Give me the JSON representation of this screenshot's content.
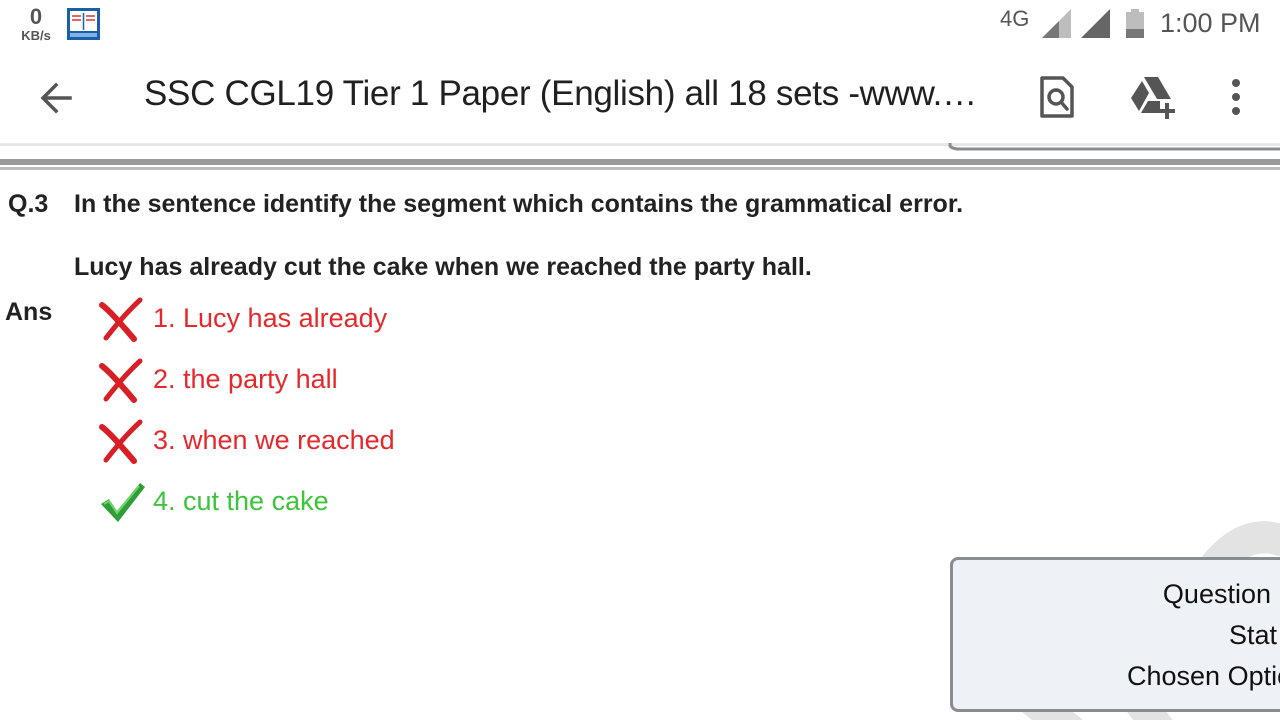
{
  "status_bar": {
    "speed_value": "0",
    "speed_unit": "KB/s",
    "network": "4G",
    "time": "1:00 PM",
    "icons": [
      "app-notification-icon",
      "signal-icon",
      "signal-icon",
      "battery-icon"
    ]
  },
  "toolbar": {
    "title": "SSC CGL19 Tier 1 Paper (English) all 18 sets -www.q...",
    "icons": [
      "back-arrow-icon",
      "find-in-document-icon",
      "add-to-drive-icon",
      "more-vert-icon"
    ]
  },
  "question": {
    "number": "Q.3",
    "text": "In the sentence identify the segment which contains the grammatical error.",
    "sentence": "Lucy has already cut the cake when we reached the party hall.",
    "answer_label": "Ans",
    "options": [
      {
        "text": "1. Lucy has already",
        "status": "wrong"
      },
      {
        "text": "2. the party hall",
        "status": "wrong"
      },
      {
        "text": "3. when we reached",
        "status": "wrong"
      },
      {
        "text": "4. cut the cake",
        "status": "correct"
      }
    ]
  },
  "status_panel": {
    "rows": [
      "Question",
      "Stat",
      "Chosen Optio"
    ]
  },
  "colors": {
    "wrong": "#e5282c",
    "correct": "#3cc53c",
    "panel_bg": "#eef1f5",
    "panel_border": "#8a8d90"
  }
}
